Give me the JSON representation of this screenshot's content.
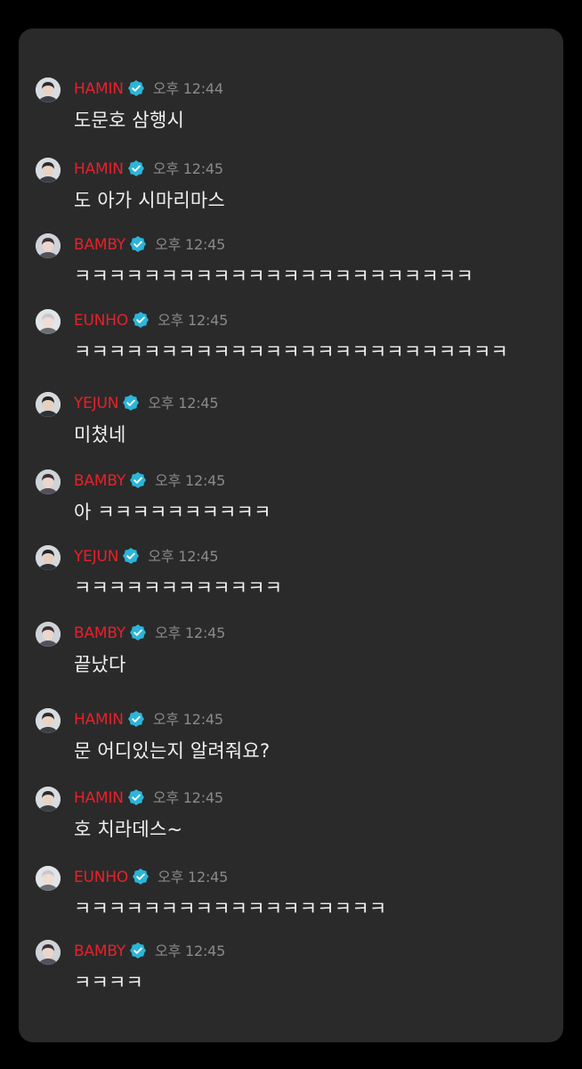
{
  "colors": {
    "page_background": "#000000",
    "panel_background": "#2a2a2a",
    "username": "#e8202a",
    "timestamp": "#8a8a8a",
    "message_text": "#f0f0f0",
    "verified_badge": "#2bb5d8"
  },
  "icons": {
    "verified": "verified-badge-icon",
    "avatar": "avatar"
  },
  "messages": [
    {
      "user": "HAMIN",
      "time": "오후 12:44",
      "text": "도문호 삼행시"
    },
    {
      "user": "HAMIN",
      "time": "오후 12:45",
      "text": "도 아가 시마리마스"
    },
    {
      "user": "BAMBY",
      "time": "오후 12:45",
      "text": "ㅋㅋㅋㅋㅋㅋㅋㅋㅋㅋㅋㅋㅋㅋㅋㅋㅋㅋㅋㅋㅋㅋㅋ"
    },
    {
      "user": "EUNHO",
      "time": "오후 12:45",
      "text": "ㅋㅋㅋㅋㅋㅋㅋㅋㅋㅋㅋㅋㅋㅋㅋㅋㅋㅋㅋㅋㅋㅋㅋㅋㅋ"
    },
    {
      "user": "YEJUN",
      "time": "오후 12:45",
      "text": "미쳤네"
    },
    {
      "user": "BAMBY",
      "time": "오후 12:45",
      "text": "아 ㅋㅋㅋㅋㅋㅋㅋㅋㅋㅋ"
    },
    {
      "user": "YEJUN",
      "time": "오후 12:45",
      "text": "ㅋㅋㅋㅋㅋㅋㅋㅋㅋㅋㅋㅋ"
    },
    {
      "user": "BAMBY",
      "time": "오후 12:45",
      "text": "끝났다"
    },
    {
      "user": "HAMIN",
      "time": "오후 12:45",
      "text": "문 어디있는지 알려줘요?"
    },
    {
      "user": "HAMIN",
      "time": "오후 12:45",
      "text": "호 치라데스~"
    },
    {
      "user": "EUNHO",
      "time": "오후 12:45",
      "text": "ㅋㅋㅋㅋㅋㅋㅋㅋㅋㅋㅋㅋㅋㅋㅋㅋㅋㅋ"
    },
    {
      "user": "BAMBY",
      "time": "오후 12:45",
      "text": "ㅋㅋㅋㅋ"
    }
  ]
}
